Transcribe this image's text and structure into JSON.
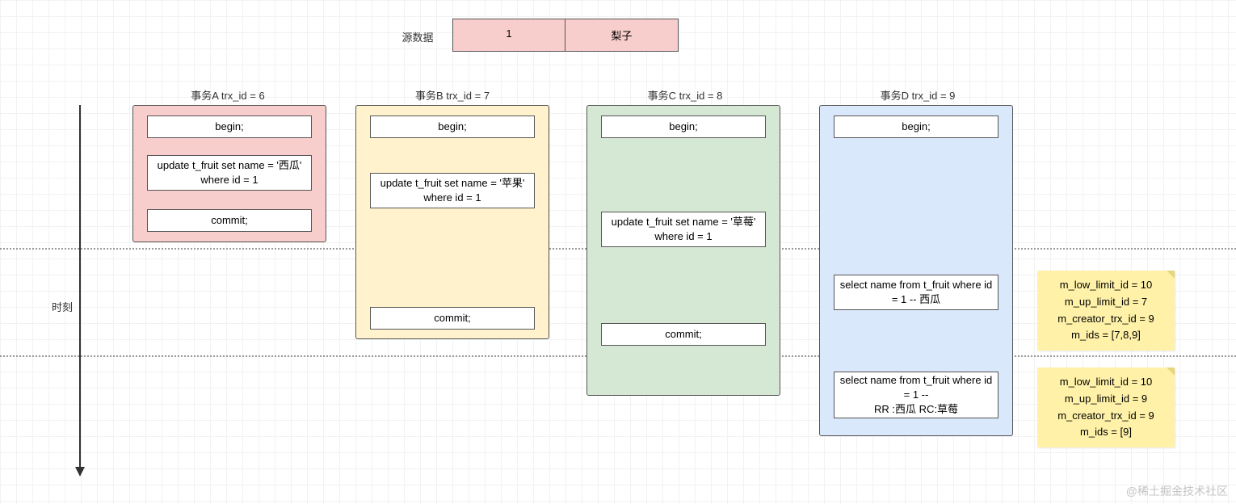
{
  "source": {
    "label": "源数据",
    "col1": "1",
    "col2": "梨子"
  },
  "timeline_label": "时刻",
  "transactions": {
    "a": {
      "title": "事务A trx_id = 6",
      "stmts": [
        "begin;",
        "update t_fruit set name = '西瓜' where id = 1",
        "commit;"
      ]
    },
    "b": {
      "title": "事务B trx_id = 7",
      "stmts": [
        "begin;",
        "update t_fruit set name = '苹果' where id = 1",
        "commit;"
      ]
    },
    "c": {
      "title": "事务C trx_id = 8",
      "stmts": [
        "begin;",
        "update t_fruit set name = '草莓' where id = 1",
        "commit;"
      ]
    },
    "d": {
      "title": "事务D trx_id = 9",
      "stmts": [
        "begin;",
        "select name from t_fruit where id = 1 -- 西瓜",
        "select name from t_fruit where id = 1 --\nRR :西瓜 RC:草莓"
      ]
    }
  },
  "notes": {
    "read_view_1": {
      "lines": [
        "m_low_limit_id = 10",
        "m_up_limit_id = 7",
        "m_creator_trx_id = 9",
        "m_ids = [7,8,9]"
      ]
    },
    "read_view_2": {
      "lines": [
        "m_low_limit_id = 10",
        "m_up_limit_id = 9",
        "m_creator_trx_id = 9",
        "m_ids = [9]"
      ]
    }
  },
  "watermark": "@稀土掘金技术社区"
}
